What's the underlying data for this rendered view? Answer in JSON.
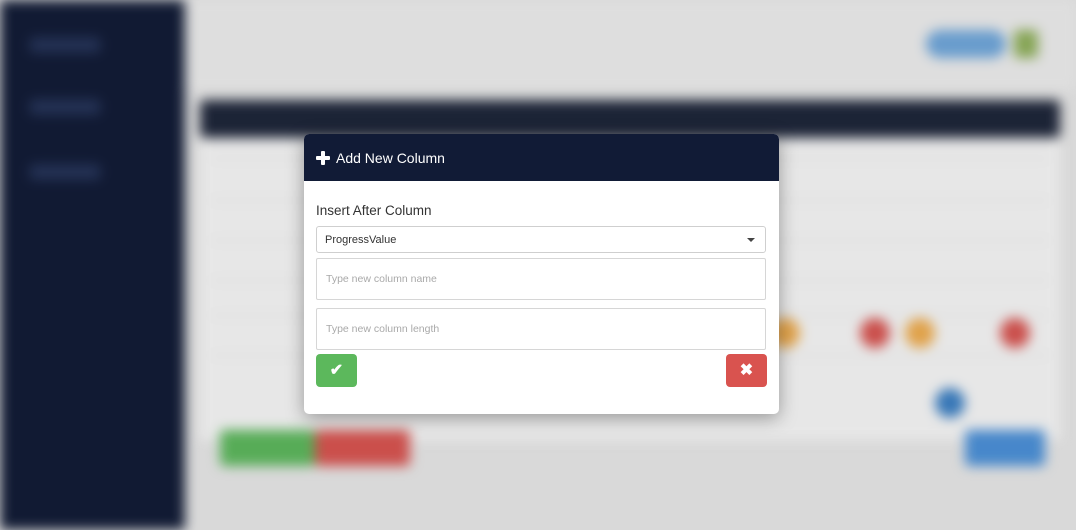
{
  "modal": {
    "title": "Add New Column",
    "header_icon": "plus-icon",
    "insert_after_label": "Insert After Column",
    "insert_after_selected": "ProgressValue",
    "column_name_placeholder": "Type new column name",
    "column_length_placeholder": "Type new column length",
    "confirm_icon": "checkmark-icon",
    "cancel_icon": "times-icon",
    "confirm_glyph": "✔",
    "cancel_glyph": "✖"
  },
  "colors": {
    "header_bg": "#111b36",
    "confirm": "#5cb85c",
    "cancel": "#d9534f",
    "sidebar": "#101a35"
  }
}
